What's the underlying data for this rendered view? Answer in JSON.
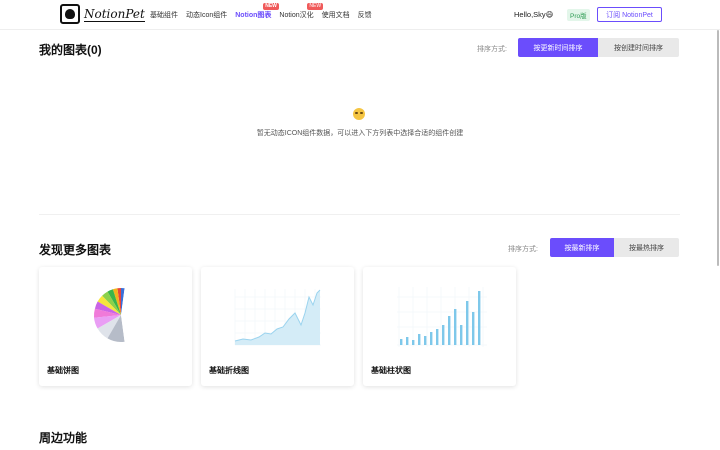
{
  "header": {
    "logo_text": "NotionPet",
    "nav": [
      {
        "label": "基础组件",
        "badge": ""
      },
      {
        "label": "动态Icon组件",
        "badge": ""
      },
      {
        "label": "Notion图表",
        "badge": "NEW"
      },
      {
        "label": "Notion汉化",
        "badge": "NEW"
      },
      {
        "label": "使用文档",
        "badge": ""
      },
      {
        "label": "反馈",
        "badge": ""
      }
    ],
    "active_nav": "Notion图表",
    "greeting": "Hello,Sky😄",
    "pro_badge": "Pro版",
    "subscribe_label": "订阅 NotionPet"
  },
  "my_charts": {
    "title": "我的图表(0)",
    "sort_label": "排序方式:",
    "sort_options": [
      "按更新时间排序",
      "按创建时间排序"
    ],
    "empty_message": "暂无动态ICON组件数据，可以进入下方列表中选择合适的组件创建"
  },
  "discover": {
    "title": "发现更多图表",
    "sort_label": "排序方式:",
    "sort_options": [
      "按最新排序",
      "按最热排序"
    ],
    "cards": [
      {
        "label": "基础饼图",
        "preview": "pie"
      },
      {
        "label": "基础折线图",
        "preview": "line"
      },
      {
        "label": "基础柱状图",
        "preview": "bar"
      }
    ]
  },
  "peripheral": {
    "title": "周边功能"
  },
  "colors": {
    "accent": "#6b4dfc",
    "new_badge": "#f05a5a",
    "pro_green": "#2c9b52",
    "chart_blue": "#7ec8ea"
  }
}
